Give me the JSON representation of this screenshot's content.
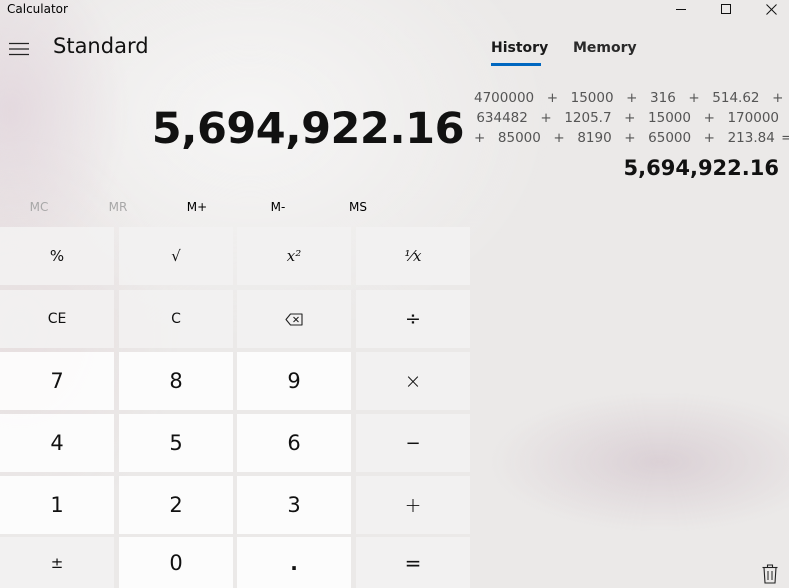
{
  "window": {
    "title": "Calculator"
  },
  "header": {
    "mode": "Standard"
  },
  "display": {
    "value": "5,694,922.16"
  },
  "memory_row": {
    "mc": "MC",
    "mr": "MR",
    "m_plus": "M+",
    "m_minus": "M-",
    "ms": "MS"
  },
  "keys": {
    "percent": "%",
    "sqrt": "√",
    "square": "x²",
    "reciprocal": "¹⁄x",
    "ce": "CE",
    "c": "C",
    "backspace": "backspace",
    "divide": "÷",
    "seven": "7",
    "eight": "8",
    "nine": "9",
    "multiply": "×",
    "four": "4",
    "five": "5",
    "six": "6",
    "minus": "−",
    "one": "1",
    "two": "2",
    "three": "3",
    "plus": "+",
    "negate": "±",
    "zero": "0",
    "decimal": ".",
    "equals": "="
  },
  "panel": {
    "tabs": [
      "History",
      "Memory"
    ],
    "active_tab": "History",
    "accent_color": "#0067c0",
    "history": {
      "expression_lines": [
        "4700000  +  15000  +  316  +  514.62  +",
        "634482  +  1205.7  +  15000  +  170000",
        "+  85000  +  8190  +  65000  +  213.84 ="
      ],
      "result": "5,694,922.16"
    }
  },
  "icons": {
    "minimize": "minimize-icon",
    "maximize": "maximize-icon",
    "close": "close-icon",
    "menu": "hamburger-menu-icon",
    "backspace": "backspace-icon",
    "clear_history": "trash-icon"
  }
}
